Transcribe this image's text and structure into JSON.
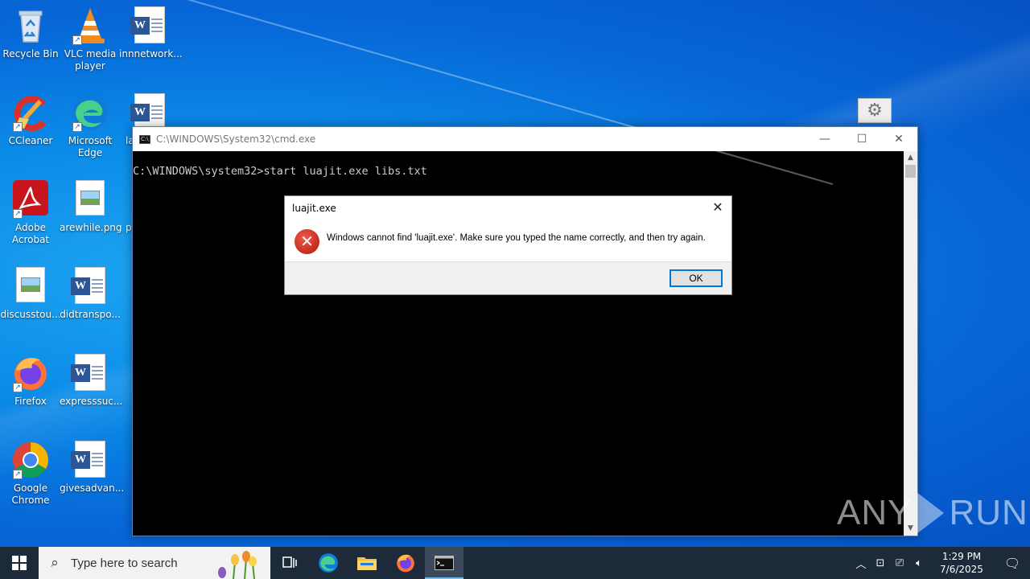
{
  "desktop_icons": [
    {
      "label": "Recycle Bin",
      "icon": "recycle-bin-icon"
    },
    {
      "label": "VLC media player",
      "icon": "vlc-icon"
    },
    {
      "label": "innnetwork...",
      "icon": "word-document-icon"
    },
    {
      "label": "CCleaner",
      "icon": "ccleaner-icon"
    },
    {
      "label": "Microsoft Edge",
      "icon": "edge-icon"
    },
    {
      "label": "la",
      "icon": "word-document-icon"
    },
    {
      "label": "Adobe Acrobat",
      "icon": "acrobat-icon"
    },
    {
      "label": "arewhile.png",
      "icon": "image-file-icon"
    },
    {
      "label": "p",
      "icon": "file-icon"
    },
    {
      "label": "discusstou...",
      "icon": "image-file-icon"
    },
    {
      "label": "didtranspo...",
      "icon": "word-document-icon"
    },
    {
      "label": "Firefox",
      "icon": "firefox-icon"
    },
    {
      "label": "expresssuc...",
      "icon": "word-document-icon"
    },
    {
      "label": "Google Chrome",
      "icon": "chrome-icon"
    },
    {
      "label": "givesadvan...",
      "icon": "word-document-icon"
    }
  ],
  "cmd_window": {
    "title": "C:\\WINDOWS\\System32\\cmd.exe",
    "console_line": "C:\\WINDOWS\\system32>start luajit.exe libs.txt",
    "minimize_glyph": "—",
    "maximize_glyph": "☐",
    "close_glyph": "✕"
  },
  "dialog": {
    "title": "luajit.exe",
    "message": "Windows cannot find 'luajit.exe'. Make sure you typed the name correctly, and then try again.",
    "ok_label": "OK",
    "close_glyph": "✕",
    "error_glyph": "✕"
  },
  "watermark": {
    "left": "ANY",
    "right": "RUN"
  },
  "taskbar": {
    "search_placeholder": "Type here to search",
    "clock_time": "1:29 PM",
    "clock_date": "7/6/2025"
  },
  "colors": {
    "desktop": "#0a8be8",
    "taskbar": "#1c2a3a",
    "error_red": "#c42b1c",
    "accent": "#0078d7"
  }
}
